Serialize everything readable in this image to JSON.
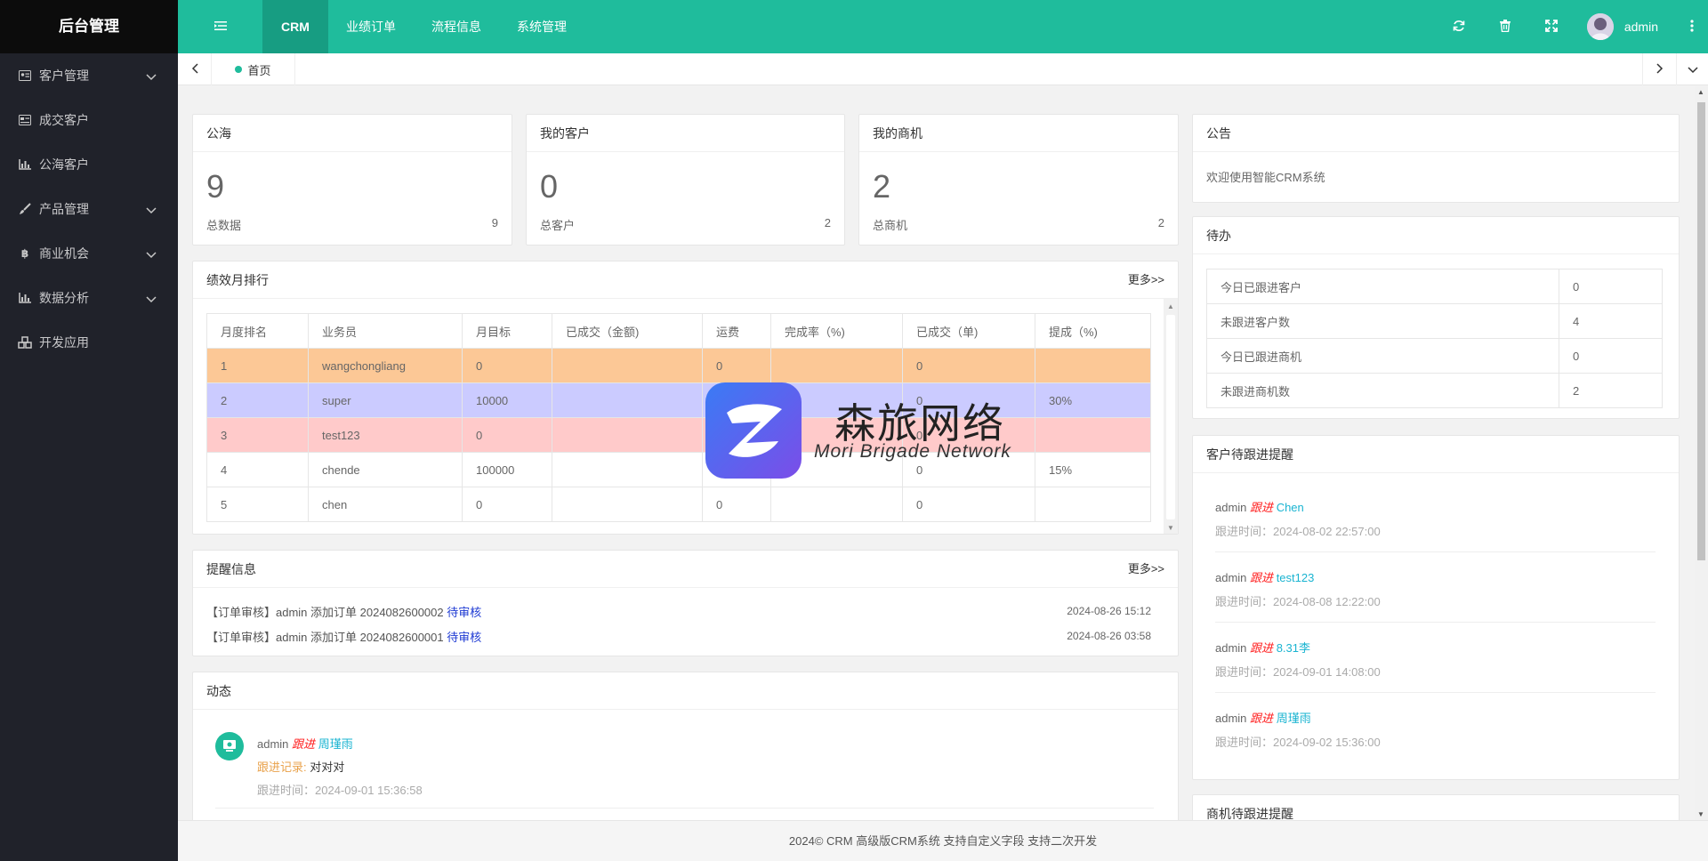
{
  "sidebar": {
    "logo": "后台管理",
    "items": [
      {
        "label": "客户管理",
        "icon": "id-card-icon",
        "has_children": true
      },
      {
        "label": "成交客户",
        "icon": "card-icon",
        "has_children": false
      },
      {
        "label": "公海客户",
        "icon": "bar-chart-icon",
        "has_children": false
      },
      {
        "label": "产品管理",
        "icon": "brush-icon",
        "has_children": true
      },
      {
        "label": "商业机会",
        "icon": "bitcoin-icon",
        "has_children": true
      },
      {
        "label": "数据分析",
        "icon": "bar-chart-icon",
        "has_children": true
      },
      {
        "label": "开发应用",
        "icon": "cubes-icon",
        "has_children": false
      }
    ]
  },
  "header": {
    "tabs": [
      {
        "label": "CRM",
        "active": true
      },
      {
        "label": "业绩订单",
        "active": false
      },
      {
        "label": "流程信息",
        "active": false
      },
      {
        "label": "系统管理",
        "active": false
      }
    ],
    "username": "admin",
    "accent": "#1fbc9c"
  },
  "tabbar": {
    "home_label": "首页"
  },
  "stats": [
    {
      "title": "公海",
      "number": "9",
      "label": "总数据",
      "value": "9"
    },
    {
      "title": "我的客户",
      "number": "0",
      "label": "总客户",
      "value": "2"
    },
    {
      "title": "我的商机",
      "number": "2",
      "label": "总商机",
      "value": "2"
    }
  ],
  "performance": {
    "title": "绩效月排行",
    "more": "更多>>",
    "columns": [
      "月度排名",
      "业务员",
      "月目标",
      "已成交（金额)",
      "运费",
      "完成率（%)",
      "已成交（单)",
      "提成（%)"
    ],
    "rows": [
      [
        "1",
        "wangchongliang",
        "0",
        "",
        "0",
        "",
        "0",
        ""
      ],
      [
        "2",
        "super",
        "10000",
        "",
        "0",
        "",
        "0",
        "30%"
      ],
      [
        "3",
        "test123",
        "0",
        "",
        "0",
        "",
        "0",
        ""
      ],
      [
        "4",
        "chende",
        "100000",
        "",
        "0",
        "",
        "0",
        "15%"
      ],
      [
        "5",
        "chen",
        "0",
        "",
        "0",
        "",
        "0",
        ""
      ]
    ]
  },
  "reminders": {
    "title": "提醒信息",
    "more": "更多>>",
    "items": [
      {
        "text": "【订单审核】admin 添加订单 2024082600002",
        "link": "待审核",
        "time": "2024-08-26 15:12"
      },
      {
        "text": "【订单审核】admin 添加订单 2024082600001",
        "link": "待审核",
        "time": "2024-08-26 03:58"
      }
    ]
  },
  "activity": {
    "title": "动态",
    "items": [
      {
        "user": "admin",
        "action": "跟进",
        "target": "周瑾雨",
        "record_label": "跟进记录:",
        "record": "对对对",
        "time": "跟进时间：2024-09-01 15:36:58"
      }
    ]
  },
  "notice": {
    "title": "公告",
    "text": "欢迎使用智能CRM系统"
  },
  "todo": {
    "title": "待办",
    "rows": [
      [
        "今日已跟进客户",
        "0"
      ],
      [
        "未跟进客户数",
        "4"
      ],
      [
        "今日已跟进商机",
        "0"
      ],
      [
        "未跟进商机数",
        "2"
      ]
    ]
  },
  "customer_follow": {
    "title": "客户待跟进提醒",
    "items": [
      {
        "user": "admin",
        "action": "跟进",
        "target": "Chen",
        "time": "跟进时间：2024-08-02 22:57:00"
      },
      {
        "user": "admin",
        "action": "跟进",
        "target": "test123",
        "time": "跟进时间：2024-08-08 12:22:00"
      },
      {
        "user": "admin",
        "action": "跟进",
        "target": "8.31李",
        "time": "跟进时间：2024-09-01 14:08:00"
      },
      {
        "user": "admin",
        "action": "跟进",
        "target": "周瑾雨",
        "time": "跟进时间：2024-09-02 15:36:00"
      }
    ]
  },
  "opportunity_follow": {
    "title": "商机待跟进提醒"
  },
  "watermark": {
    "cn": "森旅网络",
    "en": "Mori Brigade Network"
  },
  "footer": {
    "text": "2024© CRM 高级版CRM系统 支持自定义字段 支持二次开发"
  }
}
